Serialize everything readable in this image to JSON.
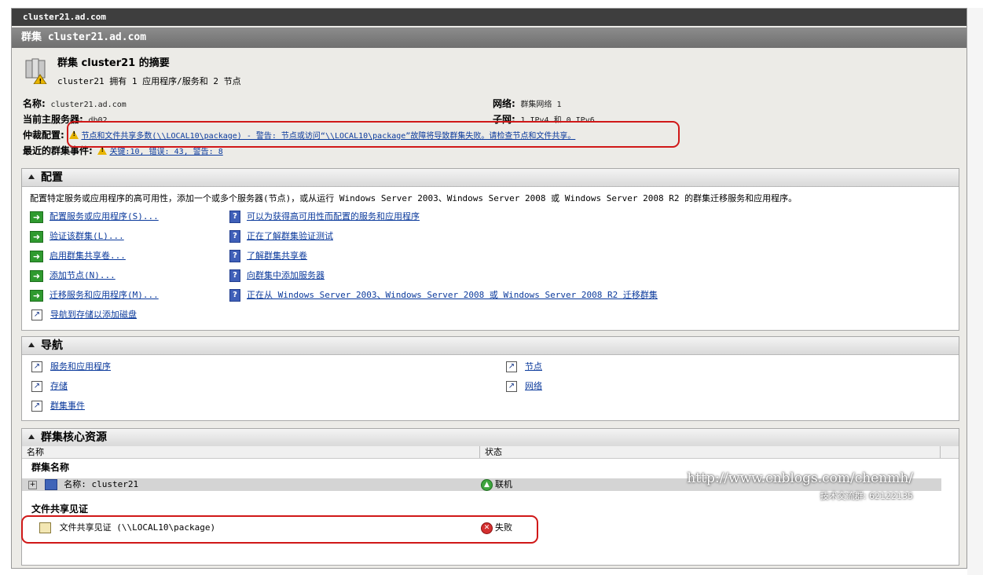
{
  "window_title": "cluster21.ad.com",
  "header_title": "群集 cluster21.ad.com",
  "summary": {
    "title": "群集 cluster21 的摘要",
    "subtitle": "cluster21 拥有 1 应用程序/服务和 2 节点"
  },
  "properties": {
    "name_label": "名称:",
    "name_value": "cluster21.ad.com",
    "host_label": "当前主服务器:",
    "host_value": "db02",
    "quorum_label": "仲裁配置:",
    "quorum_value": "节点和文件共享多数(\\\\LOCAL10\\package) - 警告: 节点或访问“\\\\LOCAL10\\package”故障将导致群集失败。请检查节点和文件共享。",
    "events_label": "最近的群集事件:",
    "events_value": "关键:10, 错误: 43, 警告: 8",
    "network_label": "网络:",
    "network_value": "群集网络 1",
    "subnet_label": "子网:",
    "subnet_value": "1 IPv4 和 0 IPv6"
  },
  "config_panel": {
    "title": "配置",
    "description": "配置特定服务或应用程序的高可用性，添加一个或多个服务器(节点)，或从运行 Windows Server 2003、Windows Server 2008 或 Windows Server 2008 R2 的群集迁移服务和应用程序。",
    "actions": [
      "配置服务或应用程序(S)...",
      "验证该群集(L)...",
      "启用群集共享卷...",
      "添加节点(N)...",
      "迁移服务和应用程序(M)...",
      "导航到存储以添加磁盘"
    ],
    "help_links": [
      "可以为获得高可用性而配置的服务和应用程序",
      "正在了解群集验证测试",
      "了解群集共享卷",
      "向群集中添加服务器",
      "正在从 Windows Server 2003、Windows Server 2008 或 Windows Server 2008 R2 迁移群集"
    ]
  },
  "nav_panel": {
    "title": "导航",
    "left_links": [
      "服务和应用程序",
      "存储",
      "群集事件"
    ],
    "right_links": [
      "节点",
      "网络"
    ]
  },
  "core_panel": {
    "title": "群集核心资源",
    "columns": [
      "名称",
      "状态"
    ],
    "group1_title": "群集名称",
    "row1_name": "名称: cluster21",
    "row1_status": "联机",
    "group2_title": "文件共享见证",
    "row2_name": "文件共享见证 (\\\\LOCAL10\\package)",
    "row2_status": "失败"
  },
  "watermark": {
    "url": "http://www.cnblogs.com/chenmh/",
    "group": "技术交流群: 62122135"
  },
  "colors": {
    "link": "#0b3a9c",
    "highlight": "#d01818",
    "warning": "#e8b400"
  }
}
